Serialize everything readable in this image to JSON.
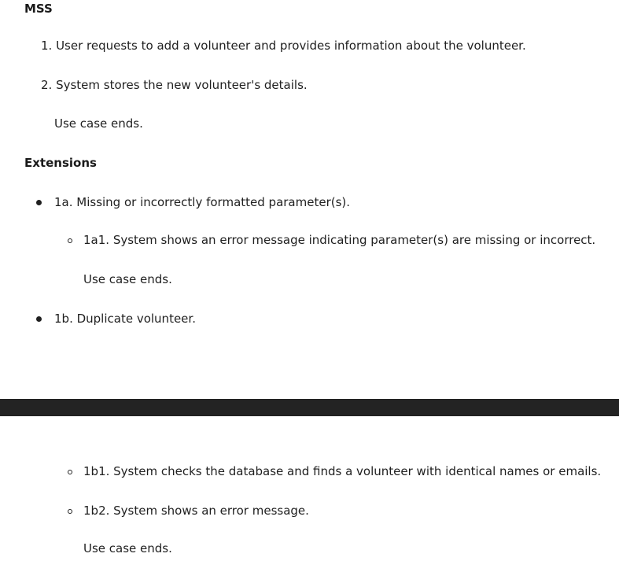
{
  "mss": {
    "heading": "MSS",
    "steps": [
      "1. User requests to add a volunteer and provides information about the volunteer.",
      "2. System stores the new volunteer's details."
    ],
    "end_note": "Use case ends."
  },
  "extensions": {
    "heading": "Extensions",
    "items": [
      {
        "label": "1a. Missing or incorrectly formatted parameter(s).",
        "sub": [
          {
            "label": "1a1. System shows an error message indicating parameter(s) are missing or incorrect."
          }
        ],
        "end_note": "Use case ends."
      },
      {
        "label": "1b. Duplicate volunteer.",
        "sub": [
          {
            "label": "1b1. System checks the database and finds a volunteer with identical names or emails."
          },
          {
            "label": "1b2. System shows an error message."
          }
        ],
        "end_note": "Use case ends."
      }
    ]
  },
  "colors": {
    "text": "#1f1f1f",
    "page_break_band": "#232323",
    "background": "#ffffff"
  }
}
